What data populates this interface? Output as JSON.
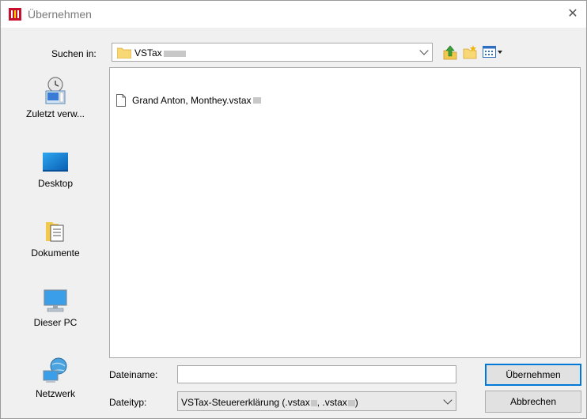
{
  "window": {
    "title": "Übernehmen",
    "close_glyph": "✕"
  },
  "toolbar": {
    "look_in_label": "Suchen in:",
    "look_in_value": "VSTax",
    "icons": [
      "go-up-icon",
      "new-folder-icon",
      "view-menu-icon"
    ]
  },
  "places": [
    {
      "label": "Zuletzt verw...",
      "icon": "recent-places-icon"
    },
    {
      "label": "Desktop",
      "icon": "desktop-icon"
    },
    {
      "label": "Dokumente",
      "icon": "documents-icon"
    },
    {
      "label": "Dieser PC",
      "icon": "this-pc-icon"
    },
    {
      "label": "Netzwerk",
      "icon": "network-icon"
    }
  ],
  "files": [
    {
      "name": "Grand Anton, Monthey.vstax"
    }
  ],
  "footer": {
    "filename_label": "Dateiname:",
    "filename_value": "",
    "filetype_label": "Dateityp:",
    "filetype_value": "VSTax-Steuererklärung (.vstax",
    "filetype_mid": ", .vstax",
    "filetype_end": ")",
    "ok_button": "Übernehmen",
    "cancel_button": "Abbrechen"
  },
  "colors": {
    "accent": "#0078d7",
    "folder": "#f8d775",
    "app_red": "#c8102e"
  }
}
